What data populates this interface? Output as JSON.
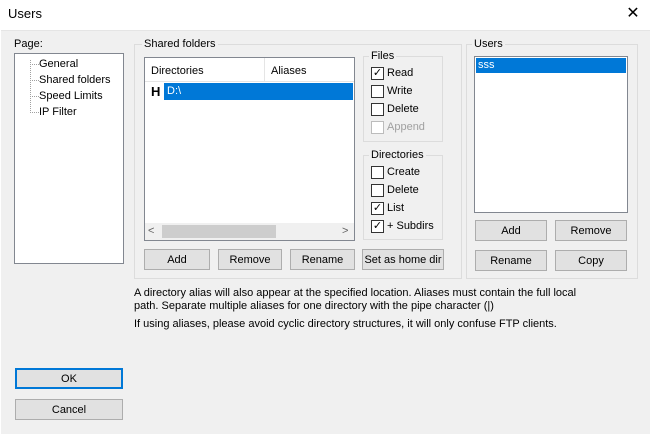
{
  "window": {
    "title": "Users",
    "close_glyph": "✕"
  },
  "page_label": "Page:",
  "tree": [
    "General",
    "Shared folders",
    "Speed Limits",
    "IP Filter"
  ],
  "shared": {
    "title": "Shared folders",
    "col_directories": "Directories",
    "col_aliases": "Aliases",
    "rows": [
      {
        "flag": "H",
        "dir": "D:\\",
        "alias": ""
      }
    ],
    "scroll_left": "<",
    "scroll_right": ">",
    "buttons": {
      "add": "Add",
      "remove": "Remove",
      "rename": "Rename",
      "home": "Set as home dir"
    }
  },
  "files": {
    "title": "Files",
    "items": [
      {
        "label": "Read",
        "checked": true,
        "disabled": false
      },
      {
        "label": "Write",
        "checked": false,
        "disabled": false
      },
      {
        "label": "Delete",
        "checked": false,
        "disabled": false
      },
      {
        "label": "Append",
        "checked": false,
        "disabled": true
      }
    ]
  },
  "directories": {
    "title": "Directories",
    "items": [
      {
        "label": "Create",
        "checked": false
      },
      {
        "label": "Delete",
        "checked": false
      },
      {
        "label": "List",
        "checked": true
      },
      {
        "label": "+ Subdirs",
        "checked": true
      }
    ]
  },
  "users": {
    "title": "Users",
    "list": [
      "sss"
    ],
    "buttons": {
      "add": "Add",
      "remove": "Remove",
      "rename": "Rename",
      "copy": "Copy"
    }
  },
  "info": {
    "line1": "A directory alias will also appear at the specified location. Aliases must contain the full local",
    "line2": "path. Separate multiple aliases for one directory with the pipe character (|)",
    "line3": "If using aliases, please avoid cyclic directory structures, it will only confuse FTP clients."
  },
  "ok": "OK",
  "cancel": "Cancel",
  "check_glyph": "✓",
  "colors": {
    "accent": "#0078d7",
    "dialog_bg": "#f0f0f0"
  }
}
